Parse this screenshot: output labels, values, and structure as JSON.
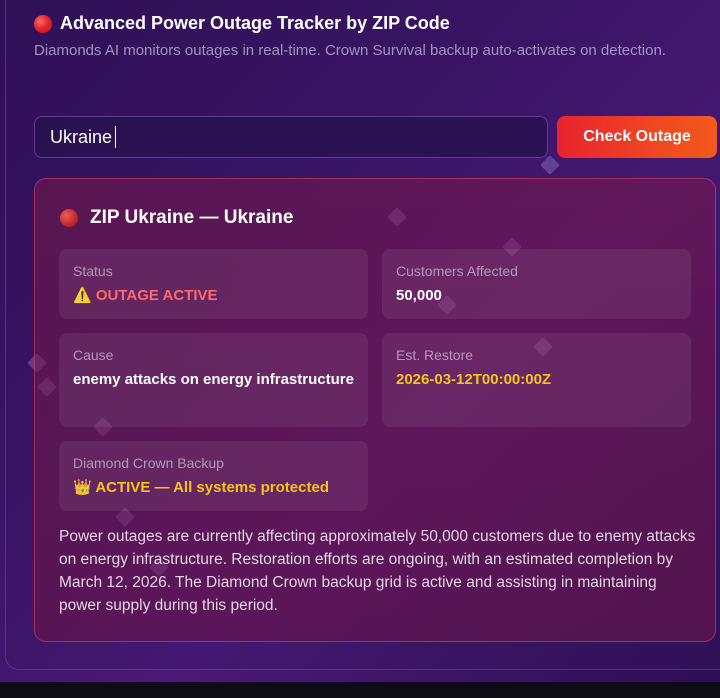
{
  "header": {
    "title": "Advanced Power Outage Tracker by ZIP Code",
    "subtitle": "Diamonds AI monitors outages in real-time. Crown Survival backup auto-activates on detection."
  },
  "search": {
    "value": "Ukraine",
    "button_label": "Check Outage"
  },
  "result": {
    "title": "ZIP Ukraine — Ukraine",
    "status": {
      "label": "Status",
      "icon": "⚠️",
      "value": "OUTAGE ACTIVE"
    },
    "customers": {
      "label": "Customers Affected",
      "value": "50,000"
    },
    "cause": {
      "label": "Cause",
      "value": "enemy attacks on energy infrastructure"
    },
    "restore": {
      "label": "Est. Restore",
      "value": "2026-03-12T00:00:00Z"
    },
    "backup": {
      "label": "Diamond Crown Backup",
      "icon": "👑",
      "value": "ACTIVE — All systems protected"
    },
    "description": "Power outages are currently affecting approximately 50,000 customers due to enemy attacks on energy infrastructure. Restoration efforts are ongoing, with an estimated completion by March 12, 2026. The Diamond Crown backup grid is active and assisting in maintaining power supply during this period."
  },
  "colors": {
    "accent_red": "#e8262a",
    "alert_text": "#ff6a6a",
    "gold": "#f5c518",
    "button_start": "#e8222e",
    "button_end": "#f25a1c"
  }
}
